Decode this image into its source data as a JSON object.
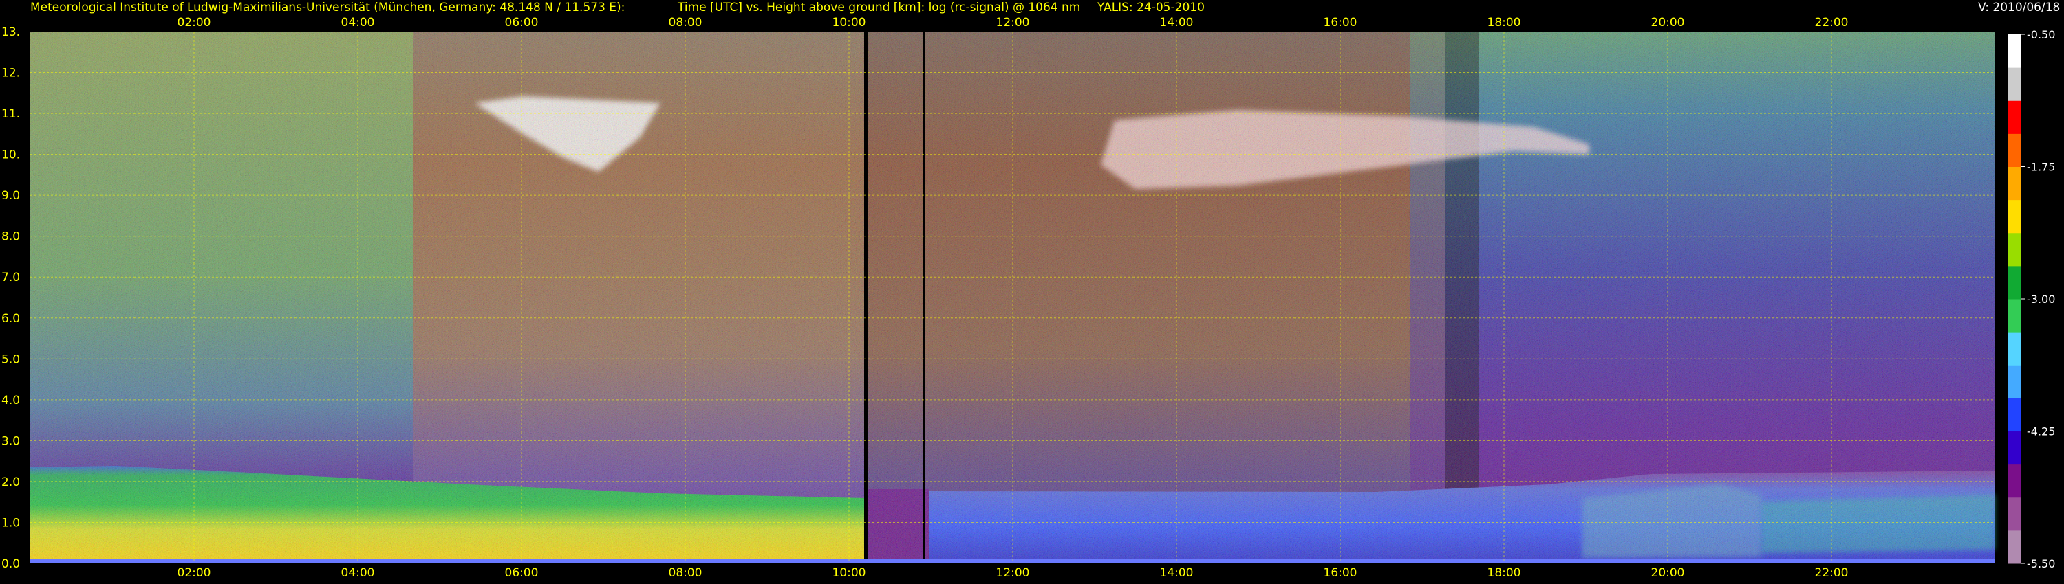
{
  "header": {
    "institute": "Meteorological Institute of Ludwig-Maximilians-Universität (München, Germany: 48.148 N / 11.573 E):",
    "plot_title": "Time [UTC] vs. Height above ground [km]: log (rc-signal) @ 1064 nm",
    "station_date": "YALIS: 24-05-2010",
    "version": "V: 2010/06/18"
  },
  "chart_data": {
    "type": "heatmap",
    "x_axis": {
      "quantity": "time_utc_hours",
      "range": [
        0,
        24
      ],
      "ticks": [
        2,
        4,
        6,
        8,
        10,
        12,
        14,
        16,
        18,
        20,
        22
      ],
      "tick_labels": [
        "02:00",
        "04:00",
        "06:00",
        "08:00",
        "10:00",
        "12:00",
        "14:00",
        "16:00",
        "18:00",
        "20:00",
        "22:00"
      ]
    },
    "y_axis": {
      "quantity": "height_km",
      "range": [
        0,
        13
      ],
      "ticks": [
        0,
        1,
        2,
        3,
        4,
        5,
        6,
        7,
        8,
        9,
        10,
        11,
        12,
        13
      ],
      "tick_labels": [
        "0.0",
        "1.0",
        "2.0",
        "3.0",
        "4.0",
        "5.0",
        "6.0",
        "7.0",
        "8.0",
        "9.0",
        "10.",
        "11.",
        "12.",
        "13."
      ]
    },
    "grid": true,
    "grid_color": "#ffff00",
    "colorbar": {
      "range": [
        -5.5,
        -0.5
      ],
      "ticks": [
        -0.5,
        -1.75,
        -3.0,
        -4.25,
        -5.5
      ],
      "tick_labels": [
        "-0.50",
        "-1.75",
        "-3.00",
        "-4.25",
        "-5.50"
      ],
      "colors": [
        "#b08ab0",
        "#9a4f9a",
        "#7a0f8a",
        "#3300cc",
        "#2244ff",
        "#44aaff",
        "#55d4ff",
        "#33cc55",
        "#11aa33",
        "#99dd00",
        "#ffdd00",
        "#ffaa00",
        "#ff6600",
        "#ff0000",
        "#cccccc",
        "#ffffff"
      ]
    },
    "features": {
      "cirrus_layers": [
        {
          "t_start": 5.5,
          "t_end": 8.0,
          "h_low": 9.7,
          "h_high": 11.3
        },
        {
          "t_start": 13.0,
          "t_end": 19.1,
          "h_low": 9.0,
          "h_high": 11.3
        }
      ],
      "boundary_layer_top_km": [
        {
          "t": 0.0,
          "h": 2.2
        },
        {
          "t": 4.0,
          "h": 2.2
        },
        {
          "t": 6.0,
          "h": 2.0
        },
        {
          "t": 8.0,
          "h": 1.8
        },
        {
          "t": 10.1,
          "h": 1.7
        },
        {
          "t": 12.0,
          "h": 1.7
        },
        {
          "t": 16.0,
          "h": 1.7
        },
        {
          "t": 19.0,
          "h": 1.9
        },
        {
          "t": 20.0,
          "h": 2.1
        },
        {
          "t": 24.0,
          "h": 2.3
        }
      ],
      "data_gaps_utc": [
        10.1,
        10.85
      ]
    }
  }
}
